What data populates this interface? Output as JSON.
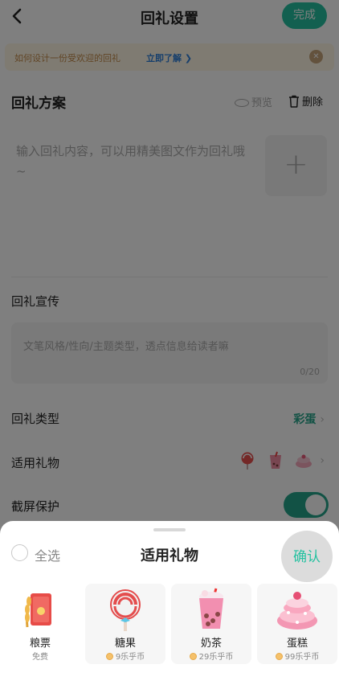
{
  "nav": {
    "title": "回礼设置",
    "done_label": "完成"
  },
  "tip": {
    "text": "如何设计一份受欢迎的回礼",
    "link": "立即了解 ❯",
    "close_glyph": "✕"
  },
  "gift_plan": {
    "title": "回礼方案",
    "preview_label": "预览",
    "delete_label": "删除",
    "content_placeholder": "输入回礼内容，可以用精美图文作为回礼哦~",
    "add_glyph": "+"
  },
  "promo": {
    "label": "回礼宣传",
    "placeholder": "文笔风格/性向/主题类型，透点信息给读者嘛",
    "counter": "0/20"
  },
  "gift_type": {
    "label": "回礼类型",
    "value": "彩蛋",
    "chevron": "›"
  },
  "applicable": {
    "label": "适用礼物",
    "chevron": "›",
    "icons": [
      "lollipop-icon",
      "milk-tea-icon",
      "cake-icon"
    ]
  },
  "screenshot_protect": {
    "label": "截屏保护",
    "enabled": true
  },
  "sheet": {
    "select_all_label": "全选",
    "title": "适用礼物",
    "confirm_label": "确认",
    "gifts": [
      {
        "name": "粮票",
        "price": "免费",
        "icon": "grain-ticket-icon",
        "has_coin": false
      },
      {
        "name": "糖果",
        "price": "9乐乎币",
        "icon": "lollipop-icon",
        "has_coin": true
      },
      {
        "name": "奶茶",
        "price": "29乐乎币",
        "icon": "milk-tea-icon",
        "has_coin": true
      },
      {
        "name": "蛋糕",
        "price": "99乐乎币",
        "icon": "cake-icon",
        "has_coin": true
      }
    ]
  },
  "colors": {
    "accent": "#25c1a0",
    "accent_dark": "#25a58a",
    "tip_bg": "#fff7e5",
    "tip_link": "#2f7fd9"
  }
}
